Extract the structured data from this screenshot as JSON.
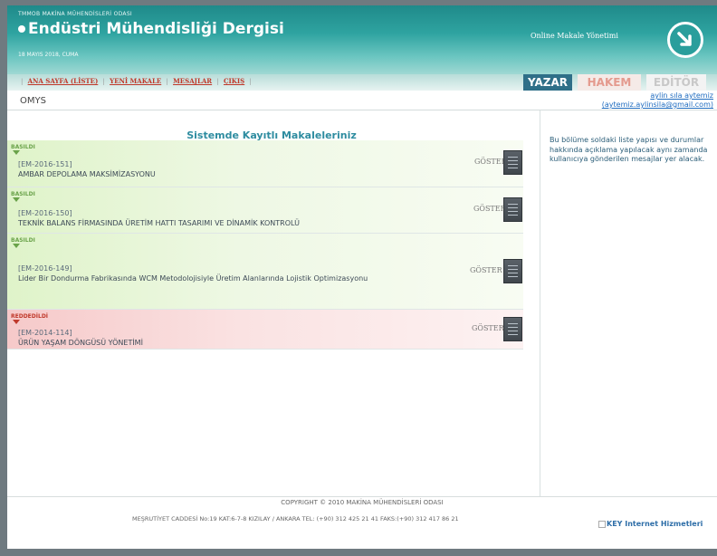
{
  "header": {
    "org_name": "TMMOB MAKİNA MÜHENDİSLERİ ODASI",
    "journal_title": "Endüstri Mühendisliği Dergisi",
    "date": "18 MAYIS 2018, CUMA",
    "online_label": "Online Makale Yönetimi",
    "logo_icon": "arrow-circle-icon"
  },
  "nav": {
    "items": [
      "ANA SAYFA (LİSTE)",
      "YENİ MAKALE",
      "MESAJLAR",
      "ÇIKIŞ"
    ]
  },
  "role_tabs": [
    "YAZAR",
    "HAKEM",
    "EDİTÖR"
  ],
  "breadcrumb": "OMYS",
  "user": {
    "name": "aylin sıla aytemiz",
    "email": "(aytemiz.aylinsila@gmail.com)"
  },
  "main": {
    "section_title": "Sistemde Kayıtlı Makaleleriniz",
    "show_label": "GÖSTER",
    "articles": [
      {
        "status": "BASILDI",
        "code": "[EM-2016-151]",
        "title": "AMBAR DEPOLAMA MAKSİMİZASYONU"
      },
      {
        "status": "BASILDI",
        "code": "[EM-2016-150]",
        "title": "TEKNİK BALANS FİRMASINDA ÜRETİM HATTI TASARIMI VE DİNAMİK KONTROLÜ"
      },
      {
        "status": "BASILDI",
        "code": "[EM-2016-149]",
        "title": "Lider Bir Dondurma Fabrikasında WCM Metodolojisiyle Üretim Alanlarında Lojistik Optimizasyonu"
      },
      {
        "status": "REDDEDİLDİ",
        "code": "[EM-2014-114]",
        "title": "ÜRÜN YAŞAM DÖNGÜSÜ YÖNETİMİ"
      }
    ]
  },
  "sidebar": {
    "info_text": "Bu bölüme soldaki liste yapısı ve durumlar hakkında açıklama yapılacak aynı zamanda kullanıcıya gönderilen mesajlar yer alacak."
  },
  "footer": {
    "copyright": "COPYRIGHT © 2010 MAKİNA MÜHENDİSLERİ ODASI",
    "address": "MEŞRUTİYET CADDESİ No:19 KAT:6-7-8 KIZILAY / ANKARA TEL: (+90) 312 425 21 41 FAKS:(+90) 312 417 86 21",
    "partner": "KEY Internet Hizmetleri"
  },
  "colors": {
    "header": "#2ea3a0",
    "published_row": "#dff3c9",
    "rejected_row": "#f6c9c9",
    "yazar_tab": "#2f6f88",
    "link": "#c0392b"
  }
}
